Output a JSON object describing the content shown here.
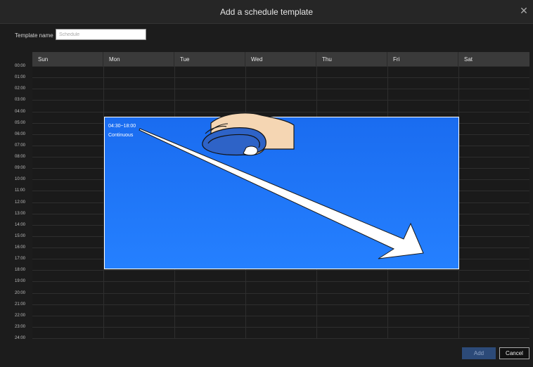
{
  "dialog": {
    "title": "Add a schedule template",
    "close_icon": "close-icon"
  },
  "template_name": {
    "label": "Template name",
    "placeholder": "Schedule",
    "value": ""
  },
  "days": [
    "Sun",
    "Mon",
    "Tue",
    "Wed",
    "Thu",
    "Fri",
    "Sat"
  ],
  "hours": [
    "00:00",
    "01:00",
    "02:00",
    "03:00",
    "04:00",
    "05:00",
    "06:00",
    "07:00",
    "08:00",
    "09:00",
    "10:00",
    "11:00",
    "12:00",
    "13:00",
    "14:00",
    "15:00",
    "16:00",
    "17:00",
    "18:00",
    "19:00",
    "20:00",
    "21:00",
    "22:00",
    "23:00",
    "24:00"
  ],
  "schedule_block": {
    "time_range": "04:30~18:00",
    "mode": "Continuous",
    "color": "#1f74f7",
    "days": [
      "Mon",
      "Tue",
      "Wed",
      "Thu",
      "Fri"
    ]
  },
  "overlay": {
    "icons": [
      "hand-mouse-icon",
      "drag-arrow-icon"
    ]
  },
  "buttons": {
    "add": "Add",
    "cancel": "Cancel"
  }
}
